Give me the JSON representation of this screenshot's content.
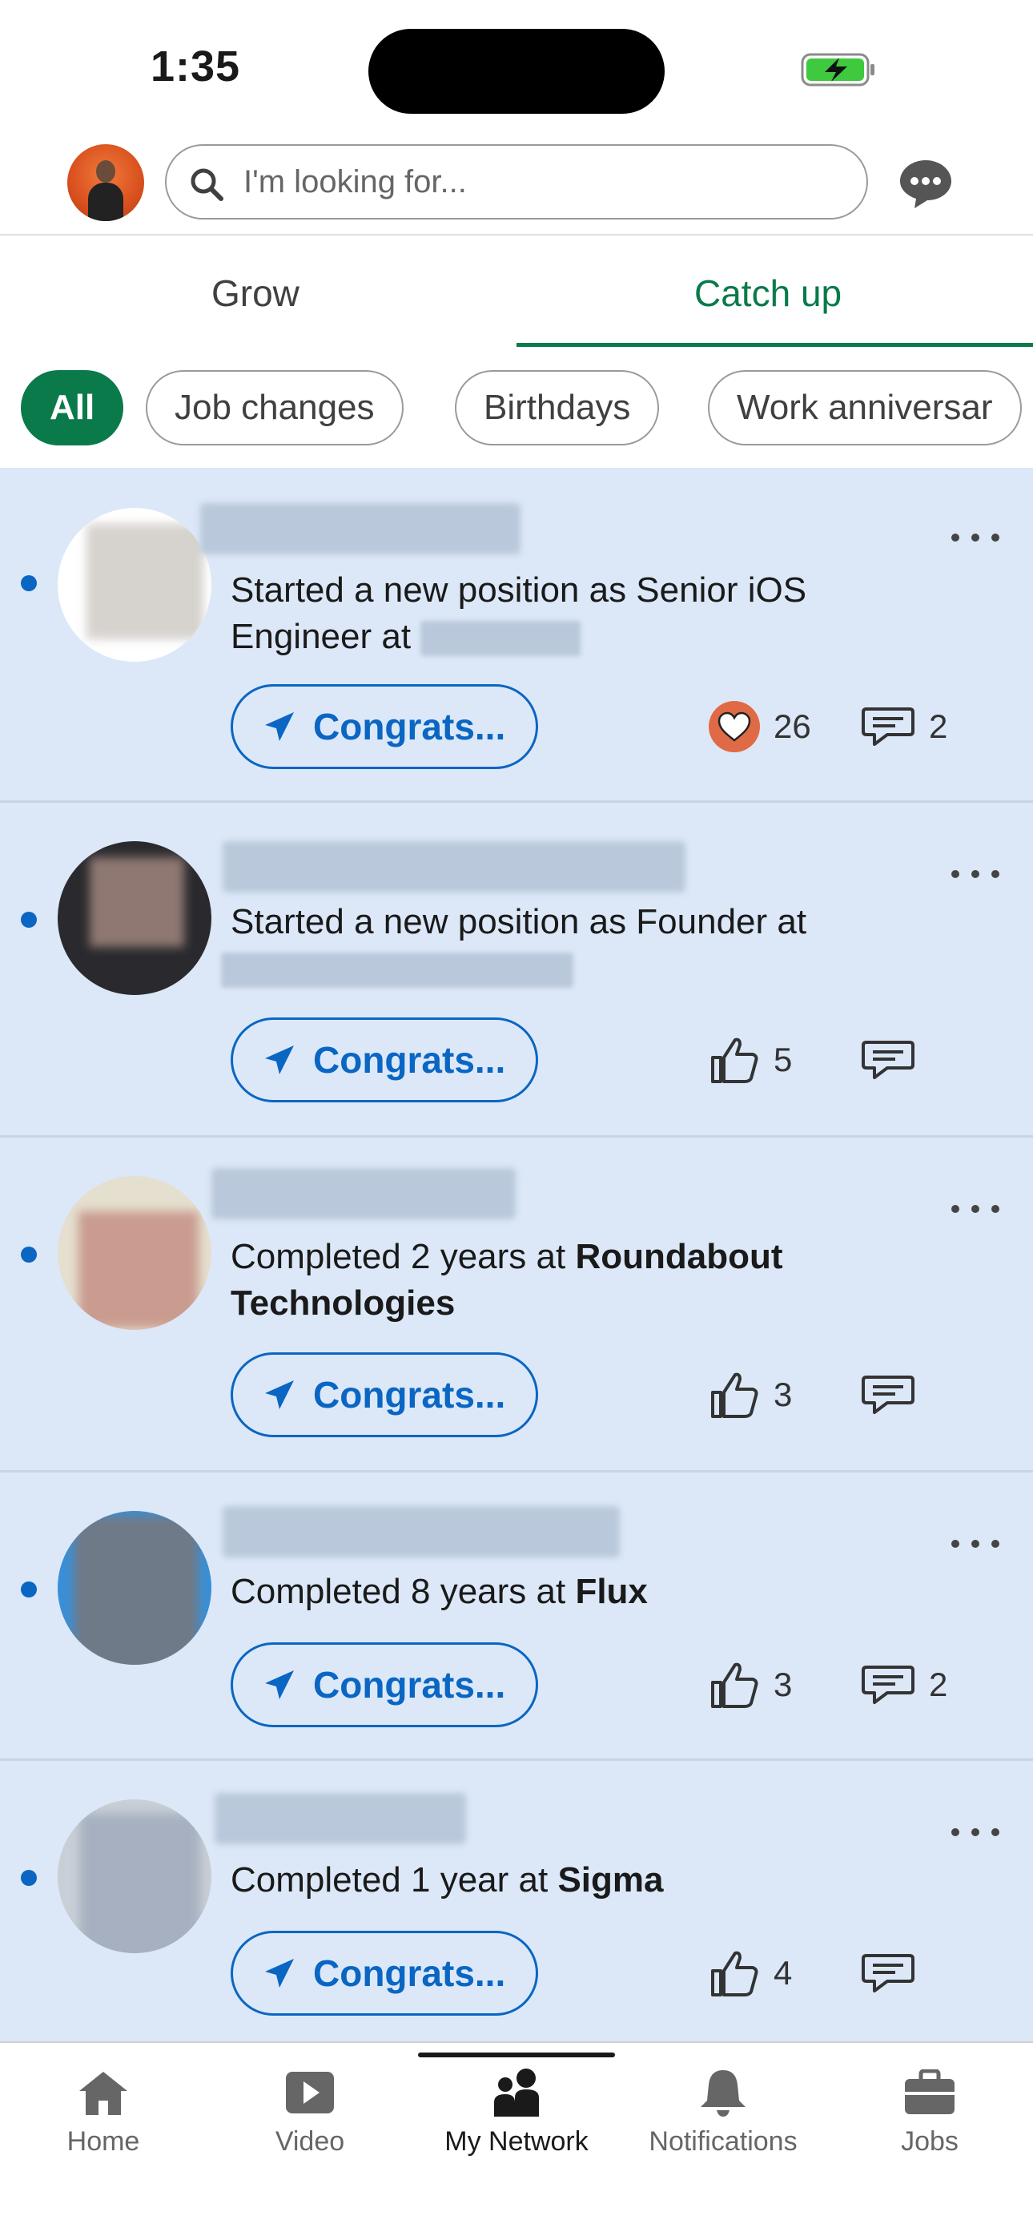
{
  "status_bar": {
    "time": "1:35"
  },
  "search": {
    "placeholder": "I'm looking for..."
  },
  "tabs": [
    {
      "label": "Grow",
      "active": false
    },
    {
      "label": "Catch up",
      "active": true
    }
  ],
  "filters": [
    {
      "label": "All",
      "active": true
    },
    {
      "label": "Job changes",
      "active": false
    },
    {
      "label": "Birthdays",
      "active": false
    },
    {
      "label": "Work anniversar",
      "active": false
    }
  ],
  "feed": [
    {
      "desc_pre": "Started a new position as Senior iOS Engineer at",
      "desc_bold": "",
      "button": "Congrats...",
      "reaction_icon": "heart-reaction-icon",
      "reaction_count": "26",
      "comment_count": "2"
    },
    {
      "desc_pre": "Started a new position as Founder at",
      "desc_bold": "",
      "button": "Congrats...",
      "reaction_icon": "thumbs-up-icon",
      "reaction_count": "5",
      "comment_count": ""
    },
    {
      "desc_pre": "Completed 2 years at ",
      "desc_bold": "Roundabout Technologies",
      "button": "Congrats...",
      "reaction_icon": "thumbs-up-icon",
      "reaction_count": "3",
      "comment_count": ""
    },
    {
      "desc_pre": "Completed 8 years at ",
      "desc_bold": "Flux",
      "button": "Congrats...",
      "reaction_icon": "thumbs-up-icon",
      "reaction_count": "3",
      "comment_count": "2"
    },
    {
      "desc_pre": "Completed 1 year at ",
      "desc_bold": "Sigma",
      "button": "Congrats...",
      "reaction_icon": "thumbs-up-icon",
      "reaction_count": "4",
      "comment_count": ""
    }
  ],
  "bottom_nav": [
    {
      "label": "Home",
      "icon": "home-icon",
      "active": false
    },
    {
      "label": "Video",
      "icon": "video-icon",
      "active": false
    },
    {
      "label": "My Network",
      "icon": "my-network-icon",
      "active": true
    },
    {
      "label": "Notifications",
      "icon": "bell-icon",
      "active": false
    },
    {
      "label": "Jobs",
      "icon": "briefcase-icon",
      "active": false
    }
  ],
  "colors": {
    "brand_green": "#0a7a4a",
    "link_blue": "#0a66c2",
    "feed_bg": "#dce8f8"
  }
}
